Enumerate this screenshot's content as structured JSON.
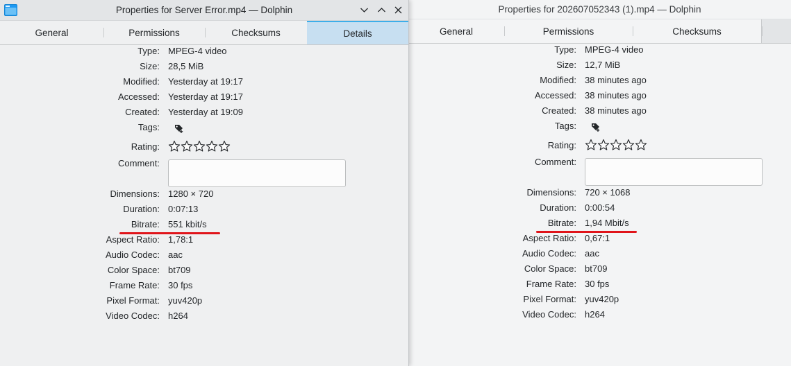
{
  "front": {
    "title": "Properties for Server Error.mp4 — Dolphin",
    "tabs": [
      "General",
      "Permissions",
      "Checksums",
      "Details"
    ],
    "active_tab": "Details",
    "fields": [
      {
        "label": "Type:",
        "value": "MPEG-4 video"
      },
      {
        "label": "Size:",
        "value": "28,5 MiB"
      },
      {
        "label": "Modified:",
        "value": "Yesterday at 19:17"
      },
      {
        "label": "Accessed:",
        "value": "Yesterday at 19:17"
      },
      {
        "label": "Created:",
        "value": "Yesterday at 19:09"
      }
    ],
    "tags_label": "Tags:",
    "rating_label": "Rating:",
    "comment_label": "Comment:",
    "rating": 0,
    "media": [
      {
        "label": "Dimensions:",
        "value": "1280 × 720"
      },
      {
        "label": "Duration:",
        "value": "0:07:13"
      },
      {
        "label": "Bitrate:",
        "value": "551 kbit/s"
      },
      {
        "label": "Aspect Ratio:",
        "value": "1,78:1"
      },
      {
        "label": "Audio Codec:",
        "value": "aac"
      },
      {
        "label": "Color Space:",
        "value": "bt709"
      },
      {
        "label": "Frame Rate:",
        "value": "30 fps"
      },
      {
        "label": "Pixel Format:",
        "value": "yuv420p"
      },
      {
        "label": "Video Codec:",
        "value": "h264"
      }
    ]
  },
  "back": {
    "title": "Properties for 202607052343 (1).mp4 — Dolphin",
    "tabs": [
      "General",
      "Permissions",
      "Checksums"
    ],
    "fields": [
      {
        "label": "Type:",
        "value": "MPEG-4 video"
      },
      {
        "label": "Size:",
        "value": "12,7 MiB"
      },
      {
        "label": "Modified:",
        "value": "38 minutes ago"
      },
      {
        "label": "Accessed:",
        "value": "38 minutes ago"
      },
      {
        "label": "Created:",
        "value": "38 minutes ago"
      }
    ],
    "tags_label": "Tags:",
    "rating_label": "Rating:",
    "comment_label": "Comment:",
    "rating": 0,
    "media": [
      {
        "label": "Dimensions:",
        "value": "720 × 1068"
      },
      {
        "label": "Duration:",
        "value": "0:00:54"
      },
      {
        "label": "Bitrate:",
        "value": "1,94 Mbit/s"
      },
      {
        "label": "Aspect Ratio:",
        "value": "0,67:1"
      },
      {
        "label": "Audio Codec:",
        "value": "aac"
      },
      {
        "label": "Color Space:",
        "value": "bt709"
      },
      {
        "label": "Frame Rate:",
        "value": "30 fps"
      },
      {
        "label": "Pixel Format:",
        "value": "yuv420p"
      },
      {
        "label": "Video Codec:",
        "value": "h264"
      }
    ]
  },
  "icons": {
    "app": "folder-icon",
    "minimize": "chevron-down-icon",
    "maximize": "chevron-up-icon",
    "close": "close-icon",
    "tag": "add-tag-icon",
    "star": "star-icon"
  },
  "colors": {
    "tab_active_bg": "#c7dff1",
    "tab_active_border": "#3daee9",
    "highlight": "#e0141a"
  }
}
